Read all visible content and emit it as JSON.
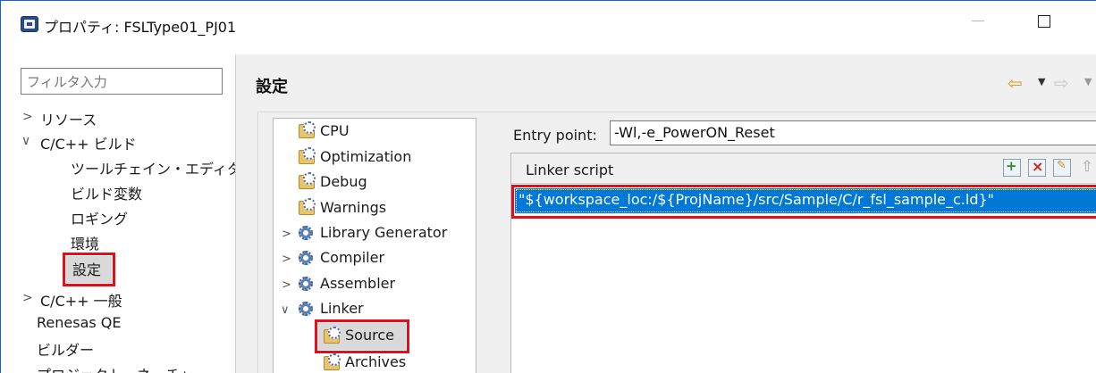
{
  "window": {
    "title": "プロパティ: FSLType01_PJ01"
  },
  "left_nav": {
    "filter_placeholder": "フィルタ入力",
    "items": [
      {
        "label": "リソース",
        "expander": ">"
      },
      {
        "label": "C/C++ ビルド",
        "expander": "∨"
      },
      {
        "label": "ツールチェイン・エディター"
      },
      {
        "label": "ビルド変数"
      },
      {
        "label": "ロギング"
      },
      {
        "label": "環境"
      },
      {
        "label": "設定",
        "selected": true
      },
      {
        "label": "C/C++ 一般",
        "expander": ">"
      },
      {
        "label": "Renesas QE"
      },
      {
        "label": "ビルダー"
      },
      {
        "label": "プロジェクト・ネーチャー"
      }
    ]
  },
  "section": {
    "title": "設定"
  },
  "tool_tree": {
    "items": [
      {
        "label": "CPU"
      },
      {
        "label": "Optimization"
      },
      {
        "label": "Debug"
      },
      {
        "label": "Warnings"
      },
      {
        "label": "Library Generator",
        "expander": ">"
      },
      {
        "label": "Compiler",
        "expander": ">"
      },
      {
        "label": "Assembler",
        "expander": ">"
      },
      {
        "label": "Linker",
        "expander": "∨"
      },
      {
        "label": "Source",
        "selected": true
      },
      {
        "label": "Archives"
      }
    ]
  },
  "entry_point": {
    "label": "Entry point:",
    "value": "-Wl,-e_PowerON_Reset"
  },
  "linker_script": {
    "label": "Linker script",
    "rows": [
      "\"${workspace_loc:/${ProjName}/src/Sample/C/r_fsl_sample_c.ld}\""
    ]
  },
  "colors": {
    "highlight_box": "#e0101a",
    "selection": "#0078d7",
    "nav_back_arrow": "#d79c19"
  },
  "icons": {
    "back": "⇦",
    "forward": "⇨",
    "dropdown": "▼",
    "move_up": "⇧",
    "move_down": "⇩"
  }
}
